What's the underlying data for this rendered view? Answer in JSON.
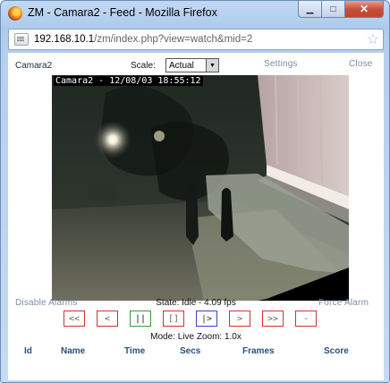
{
  "window": {
    "title": "ZM - Camara2 - Feed - Mozilla Firefox",
    "min_glyph": "▁",
    "max_glyph": "□",
    "close_glyph": "✕"
  },
  "urlbar": {
    "host": "192.168.10.1",
    "path": "/zm/index.php?view=watch&mid=2",
    "star": "☆"
  },
  "page": {
    "monitor_name": "Camara2",
    "scale_label": "Scale:",
    "scale_value": "Actual",
    "settings": "Settings",
    "close": "Close",
    "feed_timestamp": "Camara2 - 12/08/03 18:55:12",
    "disable_alarms": "Disable Alarms",
    "state": "State: Idle - 4.09 fps",
    "force_alarm": "Force Alarm",
    "controls": {
      "fast_rev": "<<",
      "slow_rev": "<",
      "pause": "||",
      "stop": "[]",
      "play": "|>",
      "slow_fwd": ">",
      "fast_fwd": ">>",
      "zoom_out": "-"
    },
    "mode": "Mode: Live   Zoom: 1.0x",
    "columns": [
      "Id",
      "Name",
      "Time",
      "Secs",
      "Frames",
      "Score"
    ]
  }
}
